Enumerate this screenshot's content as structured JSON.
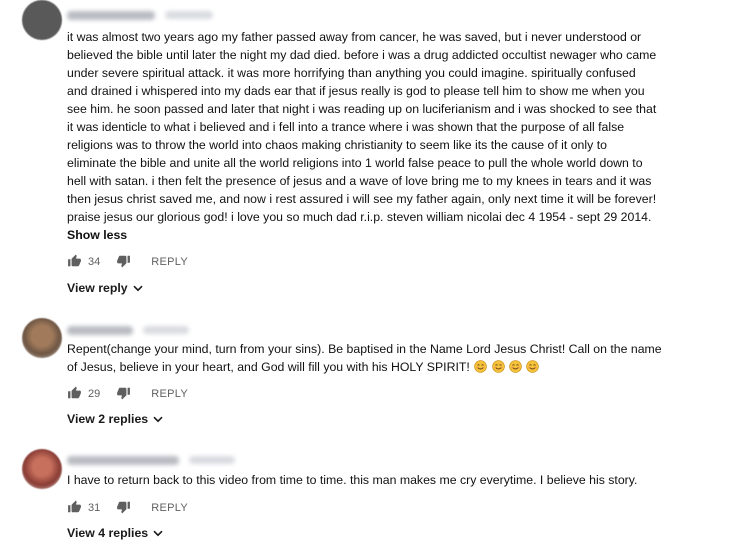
{
  "comments": [
    {
      "body_lines": [
        "it was almost two years ago my father passed away from cancer, he was saved, but i never understood or",
        "believed the bible until later the night my dad died. before i was a drug addicted occultist newager who came",
        "under severe spiritual attack. it was more horrifying than anything you could imagine. spiritually confused",
        "and drained i whispered into my dads ear that if jesus really is god to please tell him to show me when you",
        "see him. he soon passed and later that night i was reading up on luciferianism and i was shocked to see that",
        "it was identicle to what i believed and i fell into a trance where i was shown that the purpose of all false",
        "religions was to throw the world into chaos making christianity to seem like its the cause of it only to",
        "eliminate the bible and unite all the world religions into 1 world false peace to pull the whole world down to",
        "hell with satan. i then felt the presence of jesus and a wave of love bring me to my knees in tears and it was",
        "then  jesus christ saved me, and now i rest assured i will see my father again, only next time it will be forever!",
        "praise jesus our glorious god! i love you so much dad r.i.p. steven william nicolai dec 4 1954 - sept 29 2014."
      ],
      "show_less": "Show less",
      "likes": "34",
      "reply_label": "REPLY",
      "view_replies": "View reply",
      "avatar_color": "#5a5a5a"
    },
    {
      "body_lines": [
        "Repent(change your mind, turn from your sins). Be baptised in the Name Lord Jesus Christ! Call on the name",
        "of Jesus, believe in your heart, and God will fill you with his HOLY SPIRIT!"
      ],
      "emoji": [
        "smiling-face-with-smiling-eyes",
        "smiling-face-with-smiling-eyes",
        "smiling-face-with-smiling-eyes",
        "smiling-face-with-smiling-eyes"
      ],
      "likes": "29",
      "reply_label": "REPLY",
      "view_replies": "View 2 replies",
      "avatar_color": "#8a6a50"
    },
    {
      "body_lines": [
        "I have to return back to this video from time to time. this man makes me cry everytime. I believe his story."
      ],
      "likes": "31",
      "reply_label": "REPLY",
      "view_replies": "View 4 replies",
      "avatar_color": "#b04a3e"
    }
  ]
}
